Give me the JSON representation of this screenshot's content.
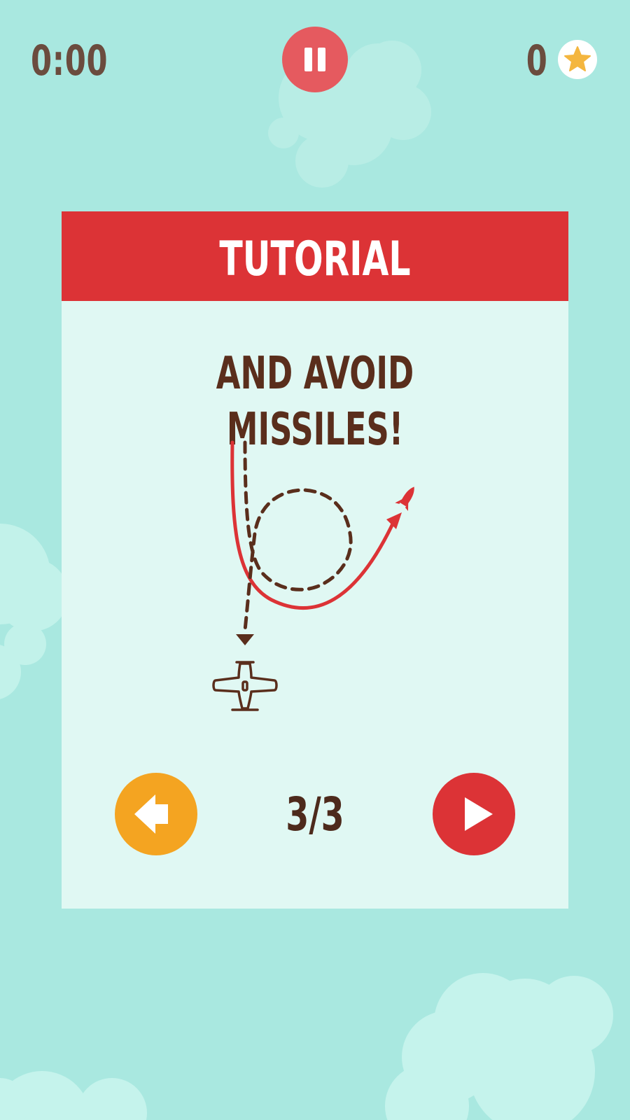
{
  "hud": {
    "timer": "0:00",
    "score": "0",
    "pause_icon": "pause-icon",
    "star_icon": "star-icon"
  },
  "tutorial": {
    "title": "TUTORIAL",
    "instruction": "AND AVOID MISSILES!",
    "page_indicator": "3/3",
    "prev_icon": "arrow-left-icon",
    "next_icon": "play-icon"
  },
  "colors": {
    "background": "#a9e8e0",
    "cloud": "#bdeee6",
    "panel": "#e0f8f3",
    "header": "#dc3336",
    "pause_button": "#e55a5f",
    "prev_button": "#f4a421",
    "next_button": "#dc3336",
    "text_dark": "#5a2e1c",
    "hud_text": "#6b4c3e",
    "star": "#f4b63f",
    "missile": "#dc3336"
  }
}
